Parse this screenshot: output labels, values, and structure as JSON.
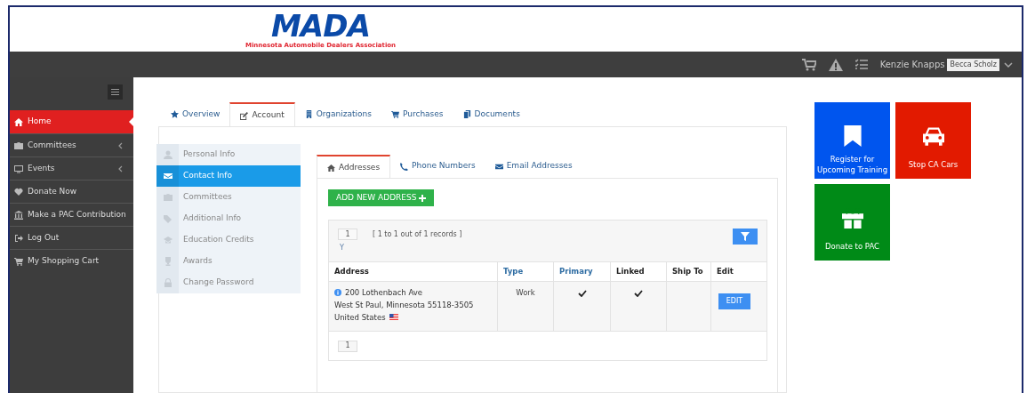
{
  "logo": {
    "wordmark": "MADA",
    "subtitle": "Minnesota Automobile Dealers Association"
  },
  "top_bar": {
    "user": "Kenzie Knapps",
    "impersonating": "Becca Scholz"
  },
  "sidebar": {
    "items": [
      {
        "label": "Home",
        "selected": true,
        "expandable": false
      },
      {
        "label": "Committees",
        "selected": false,
        "expandable": true
      },
      {
        "label": "Events",
        "selected": false,
        "expandable": true
      },
      {
        "label": "Donate Now",
        "selected": false,
        "expandable": false
      },
      {
        "label": "Make a PAC Contribution",
        "selected": false,
        "expandable": false
      },
      {
        "label": "Log Out",
        "selected": false,
        "expandable": false
      },
      {
        "label": "My Shopping Cart",
        "selected": false,
        "expandable": false
      }
    ]
  },
  "tabs": [
    {
      "label": "Overview",
      "selected": false
    },
    {
      "label": "Account",
      "selected": true
    },
    {
      "label": "Organizations",
      "selected": false
    },
    {
      "label": "Purchases",
      "selected": false
    },
    {
      "label": "Documents",
      "selected": false
    }
  ],
  "account_menu": [
    {
      "label": "Personal Info",
      "selected": false
    },
    {
      "label": "Contact Info",
      "selected": true
    },
    {
      "label": "Committees",
      "selected": false
    },
    {
      "label": "Additional Info",
      "selected": false
    },
    {
      "label": "Education Credits",
      "selected": false
    },
    {
      "label": "Awards",
      "selected": false
    },
    {
      "label": "Change Password",
      "selected": false
    }
  ],
  "contact_tabs": [
    {
      "label": "Addresses",
      "selected": true
    },
    {
      "label": "Phone Numbers",
      "selected": false
    },
    {
      "label": "Email Addresses",
      "selected": false
    }
  ],
  "add_button": "ADD NEW ADDRESS",
  "grid": {
    "page": "1",
    "records": "[ 1 to 1 out of 1 records ]",
    "filter_hint": "Y",
    "columns": [
      {
        "label": "Address",
        "sortable": false
      },
      {
        "label": "Type",
        "sortable": true
      },
      {
        "label": "Primary",
        "sortable": true
      },
      {
        "label": "Linked",
        "sortable": false
      },
      {
        "label": "Ship To",
        "sortable": false
      },
      {
        "label": "Edit",
        "sortable": false
      }
    ],
    "rows": [
      {
        "address_lines": [
          "200 Lothenbach Ave",
          "West St Paul, Minnesota 55118-3505",
          "United States"
        ],
        "type": "Work",
        "primary": true,
        "linked": true,
        "ship_to": false,
        "edit": "EDIT"
      }
    ],
    "footer_page": "1"
  },
  "tiles": [
    {
      "label": "Register for Upcoming Training",
      "color": "#0055ee"
    },
    {
      "label": "Stop CA Cars",
      "color": "#e21a00"
    },
    {
      "label": "Donate to PAC",
      "color": "#008a17"
    }
  ]
}
